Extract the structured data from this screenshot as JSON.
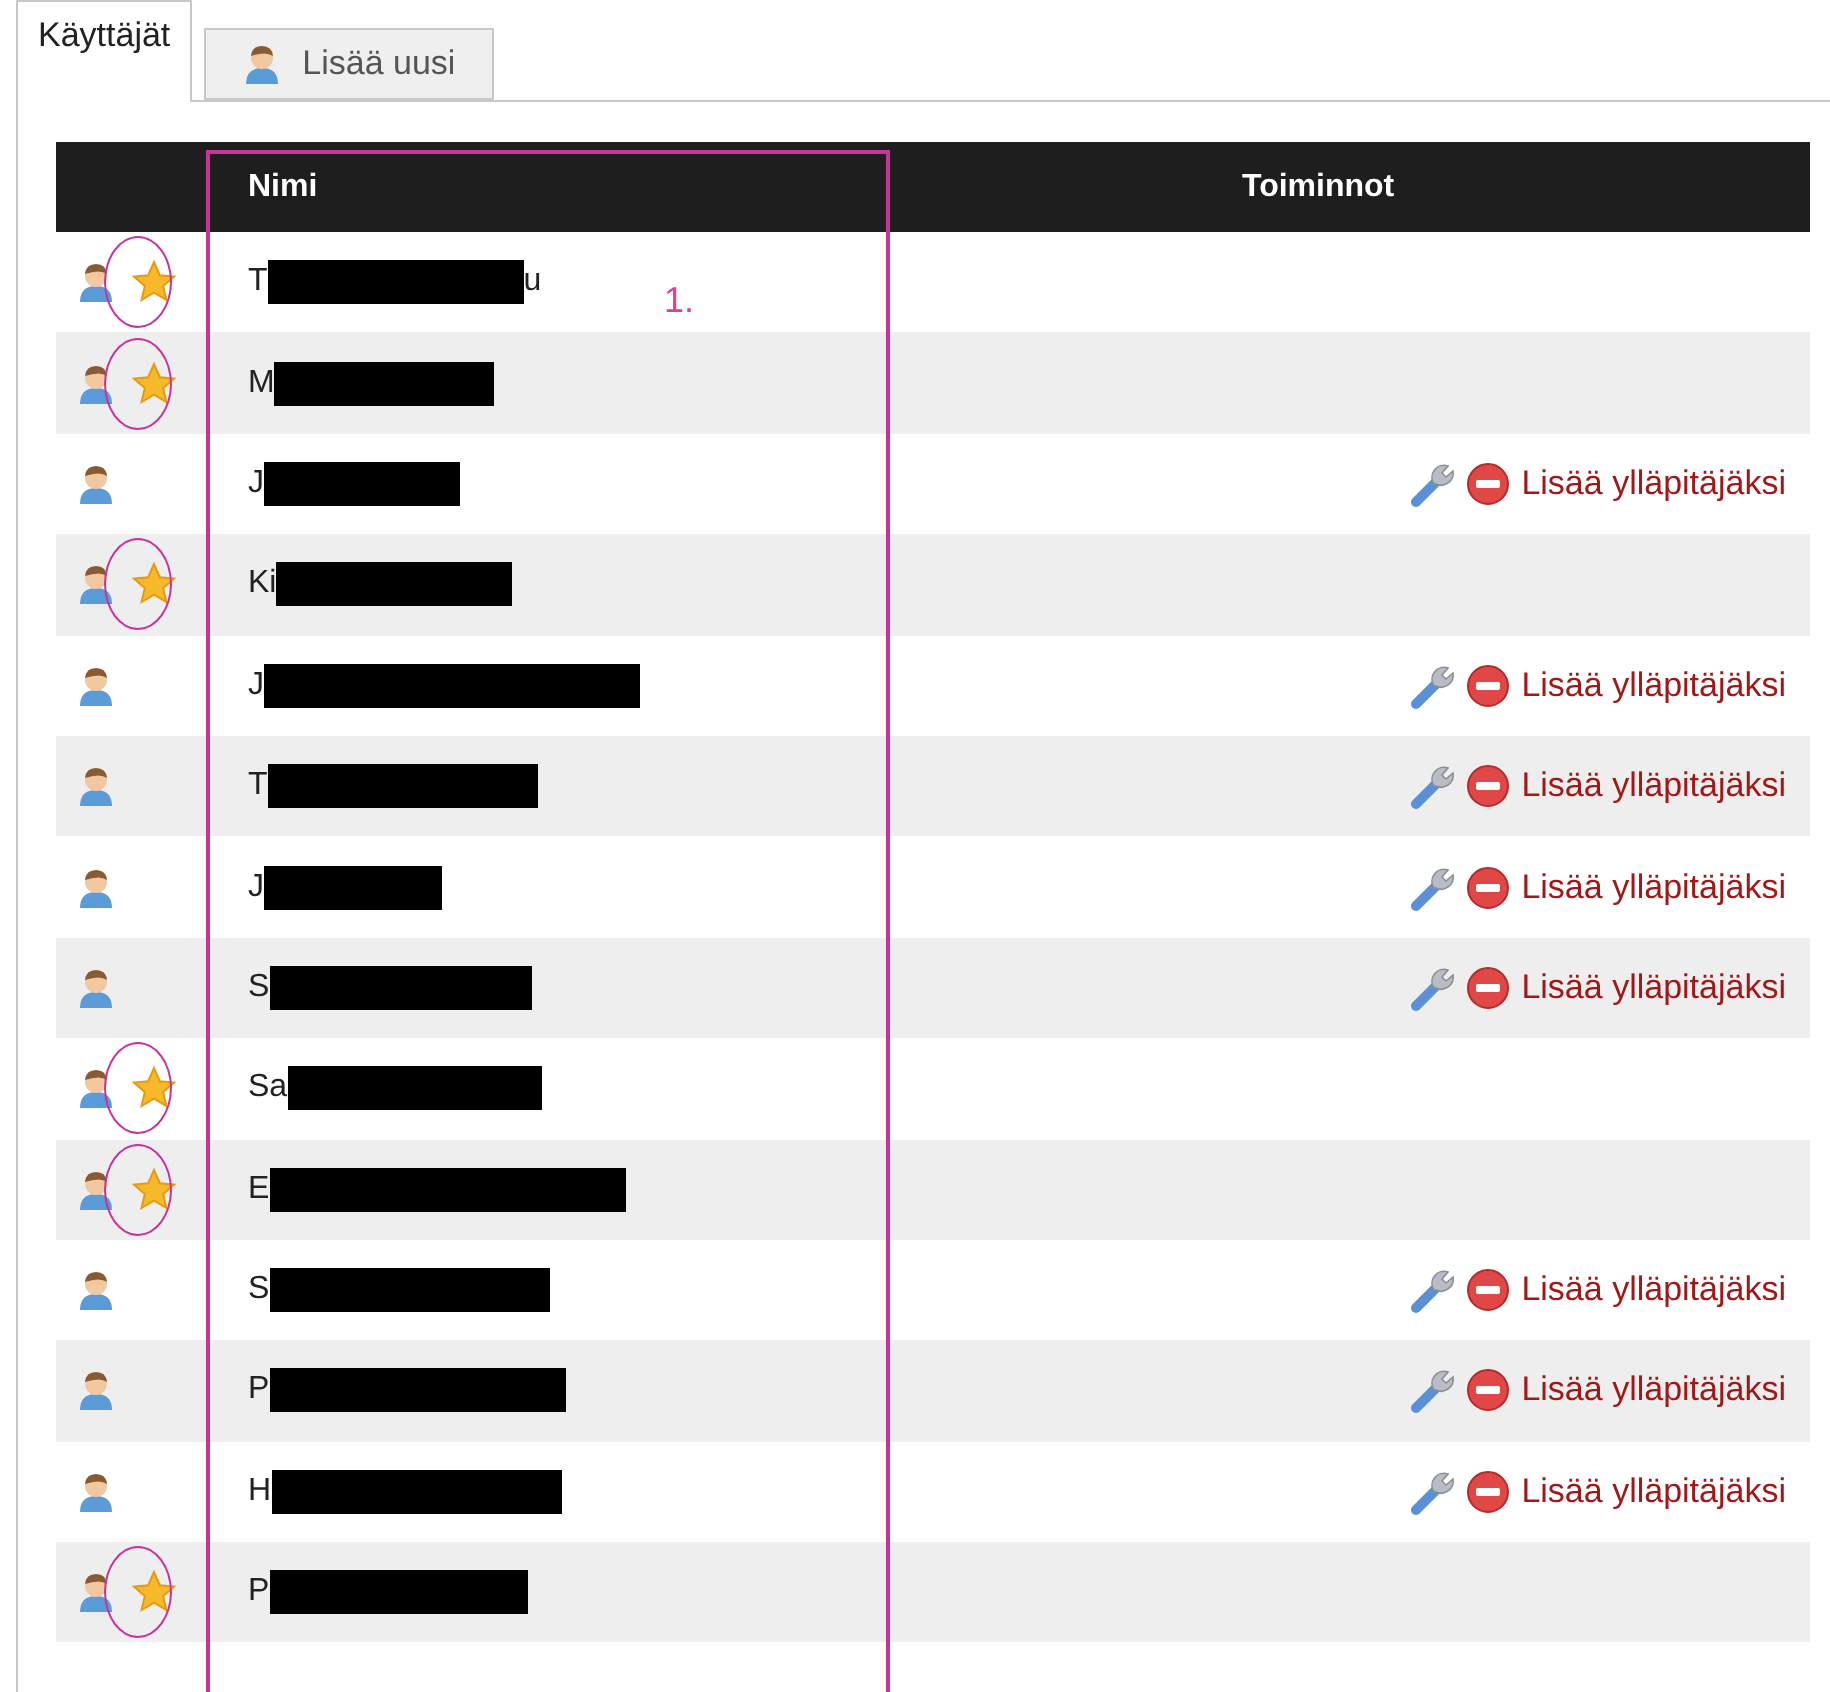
{
  "tabs": [
    {
      "label": "Käyttäjät",
      "selected": true,
      "kind": "plain"
    },
    {
      "label": "Lisää uusi",
      "selected": false,
      "kind": "add-user"
    }
  ],
  "table": {
    "columns": [
      "Nimi",
      "Toiminnot"
    ],
    "rows": [
      {
        "name_start": "T",
        "name_end": "u",
        "admin": true
      },
      {
        "name_start": "M",
        "admin": true
      },
      {
        "name_start": "J",
        "admin": false,
        "action": "Lisää ylläpitäjäksi"
      },
      {
        "name_start": "Ki",
        "admin": true
      },
      {
        "name_start": "J",
        "admin": false,
        "action": "Lisää ylläpitäjäksi"
      },
      {
        "name_start": "T",
        "admin": false,
        "action": "Lisää ylläpitäjäksi"
      },
      {
        "name_start": "J",
        "admin": false,
        "action": "Lisää ylläpitäjäksi"
      },
      {
        "name_start": "S",
        "admin": false,
        "action": "Lisää ylläpitäjäksi"
      },
      {
        "name_start": "Sa",
        "admin": true
      },
      {
        "name_start": "E",
        "admin": true
      },
      {
        "name_start": "S",
        "admin": false,
        "action": "Lisää ylläpitäjäksi"
      },
      {
        "name_start": "P",
        "admin": false,
        "action": "Lisää ylläpitäjäksi"
      },
      {
        "name_start": "H",
        "admin": false,
        "action": "Lisää ylläpitäjäksi"
      },
      {
        "name_start": "P",
        "admin": true
      }
    ]
  },
  "annotation": {
    "label": "1."
  }
}
